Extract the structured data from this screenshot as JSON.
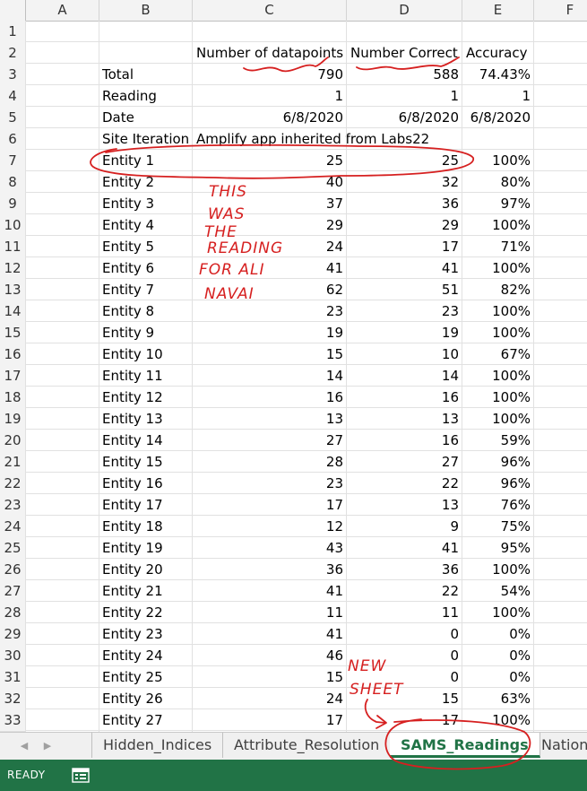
{
  "columns": [
    "A",
    "B",
    "C",
    "D",
    "E",
    "F"
  ],
  "rows": [
    {
      "n": "1",
      "b": "",
      "c": "",
      "d": "",
      "e": ""
    },
    {
      "n": "2",
      "b": "",
      "c": "Number of datapoints",
      "d": "Number Correct",
      "e": "Accuracy"
    },
    {
      "n": "3",
      "b": "Total",
      "c": "790",
      "d": "588",
      "e": "74.43%"
    },
    {
      "n": "4",
      "b": "Reading",
      "c": "1",
      "d": "1",
      "e": "1"
    },
    {
      "n": "5",
      "b": "Date",
      "c": "6/8/2020",
      "d": "6/8/2020",
      "e": "6/8/2020"
    },
    {
      "n": "6",
      "b": "Site Iteration",
      "c": "Amplify app inherited from Labs22",
      "d": "",
      "e": ""
    },
    {
      "n": "7",
      "b": "Entity 1",
      "c": "25",
      "d": "25",
      "e": "100%"
    },
    {
      "n": "8",
      "b": "Entity 2",
      "c": "40",
      "d": "32",
      "e": "80%"
    },
    {
      "n": "9",
      "b": "Entity 3",
      "c": "37",
      "d": "36",
      "e": "97%"
    },
    {
      "n": "10",
      "b": "Entity 4",
      "c": "29",
      "d": "29",
      "e": "100%"
    },
    {
      "n": "11",
      "b": "Entity 5",
      "c": "24",
      "d": "17",
      "e": "71%"
    },
    {
      "n": "12",
      "b": "Entity 6",
      "c": "41",
      "d": "41",
      "e": "100%"
    },
    {
      "n": "13",
      "b": "Entity 7",
      "c": "62",
      "d": "51",
      "e": "82%"
    },
    {
      "n": "14",
      "b": "Entity 8",
      "c": "23",
      "d": "23",
      "e": "100%"
    },
    {
      "n": "15",
      "b": "Entity 9",
      "c": "19",
      "d": "19",
      "e": "100%"
    },
    {
      "n": "16",
      "b": "Entity 10",
      "c": "15",
      "d": "10",
      "e": "67%"
    },
    {
      "n": "17",
      "b": "Entity 11",
      "c": "14",
      "d": "14",
      "e": "100%"
    },
    {
      "n": "18",
      "b": "Entity 12",
      "c": "16",
      "d": "16",
      "e": "100%"
    },
    {
      "n": "19",
      "b": "Entity 13",
      "c": "13",
      "d": "13",
      "e": "100%"
    },
    {
      "n": "20",
      "b": "Entity 14",
      "c": "27",
      "d": "16",
      "e": "59%"
    },
    {
      "n": "21",
      "b": "Entity 15",
      "c": "28",
      "d": "27",
      "e": "96%"
    },
    {
      "n": "22",
      "b": "Entity 16",
      "c": "23",
      "d": "22",
      "e": "96%"
    },
    {
      "n": "23",
      "b": "Entity 17",
      "c": "17",
      "d": "13",
      "e": "76%"
    },
    {
      "n": "24",
      "b": "Entity 18",
      "c": "12",
      "d": "9",
      "e": "75%"
    },
    {
      "n": "25",
      "b": "Entity 19",
      "c": "43",
      "d": "41",
      "e": "95%"
    },
    {
      "n": "26",
      "b": "Entity 20",
      "c": "36",
      "d": "36",
      "e": "100%"
    },
    {
      "n": "27",
      "b": "Entity 21",
      "c": "41",
      "d": "22",
      "e": "54%"
    },
    {
      "n": "28",
      "b": "Entity 22",
      "c": "11",
      "d": "11",
      "e": "100%"
    },
    {
      "n": "29",
      "b": "Entity 23",
      "c": "41",
      "d": "0",
      "e": "0%"
    },
    {
      "n": "30",
      "b": "Entity 24",
      "c": "46",
      "d": "0",
      "e": "0%"
    },
    {
      "n": "31",
      "b": "Entity 25",
      "c": "15",
      "d": "0",
      "e": "0%"
    },
    {
      "n": "32",
      "b": "Entity 26",
      "c": "24",
      "d": "15",
      "e": "63%"
    },
    {
      "n": "33",
      "b": "Entity 27",
      "c": "17",
      "d": "17",
      "e": "100%"
    }
  ],
  "sheet_tabs": [
    "Hidden_Indices",
    "Attribute_Resolution",
    "SAMS_Readings",
    "Nation"
  ],
  "active_tab": "SAMS_Readings",
  "status": {
    "text": "READY"
  },
  "annotations": {
    "note1": [
      "THIS",
      "WAS",
      "THE",
      "READING",
      "FOR ALI",
      "NAVAI"
    ],
    "note2": [
      "NEW",
      "SHEET"
    ]
  },
  "colors": {
    "annotation_ink": "#d62020",
    "excel_green": "#217346"
  },
  "icons": {
    "prev_sheet": "◀",
    "next_sheet": "▶",
    "macro": "macro-record-icon"
  }
}
